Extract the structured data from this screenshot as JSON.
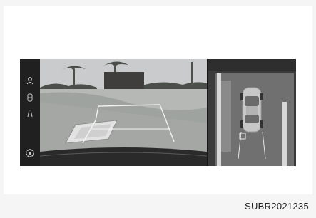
{
  "figure": {
    "caption": "SUBR2021235"
  },
  "screen": {
    "notice": "",
    "side_icons": [
      "camera-icon",
      "parking-icon",
      "guide-icon",
      "settings-icon"
    ]
  }
}
